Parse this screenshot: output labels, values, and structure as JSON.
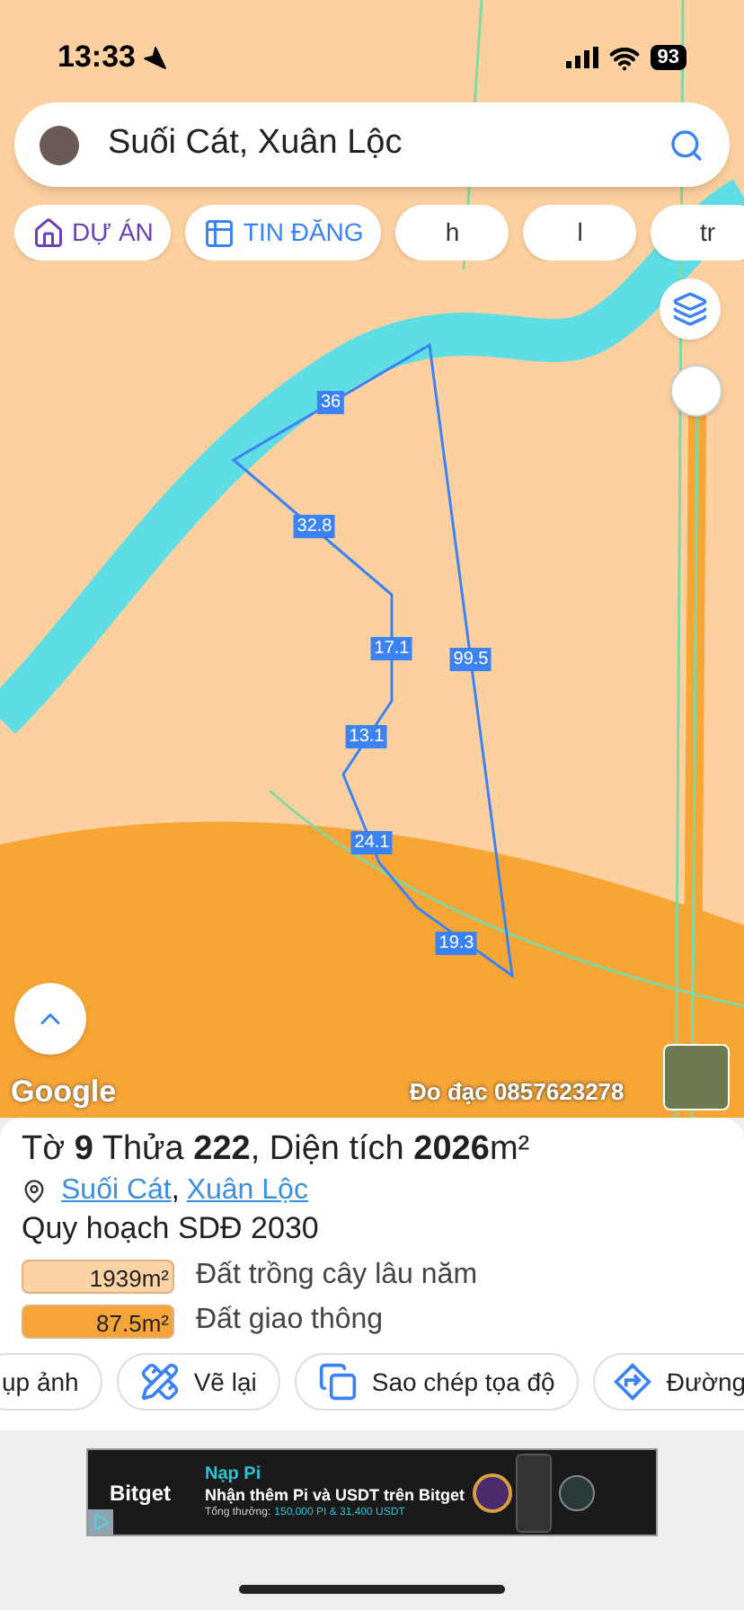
{
  "status_bar": {
    "time": "13:33",
    "battery": "93"
  },
  "search": {
    "value": "Suối Cát, Xuân Lộc"
  },
  "chips": [
    {
      "label": "DỰ ÁN",
      "kind": "project"
    },
    {
      "label": "TIN ĐĂNG",
      "kind": "listing"
    },
    {
      "label": "h",
      "kind": "plain"
    },
    {
      "label": "l",
      "kind": "plain"
    },
    {
      "label": "tr",
      "kind": "plain"
    }
  ],
  "map": {
    "edge_labels": [
      "36",
      "32.8",
      "17.1",
      "99.5",
      "13.1",
      "24.1",
      "19.3"
    ],
    "attribution": "Google",
    "surveyor": "Đo đạc 0857623278"
  },
  "parcel": {
    "title_parts": [
      "Tờ ",
      "9",
      " Thửa ",
      "222",
      ", Diện tích ",
      "2026",
      "m²"
    ],
    "locations": [
      "Suối Cát",
      "Xuân Lộc"
    ],
    "separator": ", ",
    "plan": "Quy hoạch SDĐ 2030",
    "zones": [
      {
        "area": "1939m²",
        "label": "Đất trồng cây lâu năm",
        "color": "#fbd3a4"
      },
      {
        "area": "87.5m²",
        "label": "Đất giao thông",
        "color": "#f6a43a"
      }
    ]
  },
  "actions": [
    {
      "label": "ụp ảnh",
      "kind": "photo"
    },
    {
      "label": "Vẽ lại",
      "kind": "redraw"
    },
    {
      "label": "Sao chép tọa độ",
      "kind": "copy"
    },
    {
      "label": "Đường",
      "kind": "directions"
    }
  ],
  "ad": {
    "brand": "Bitget",
    "headline": "Nạp Pi",
    "body": "Nhận thêm Pi và USDT trên Bitget",
    "reward_label": "Tổng thưởng:",
    "reward_value": "150,000 PI & 31,400 USDT"
  }
}
